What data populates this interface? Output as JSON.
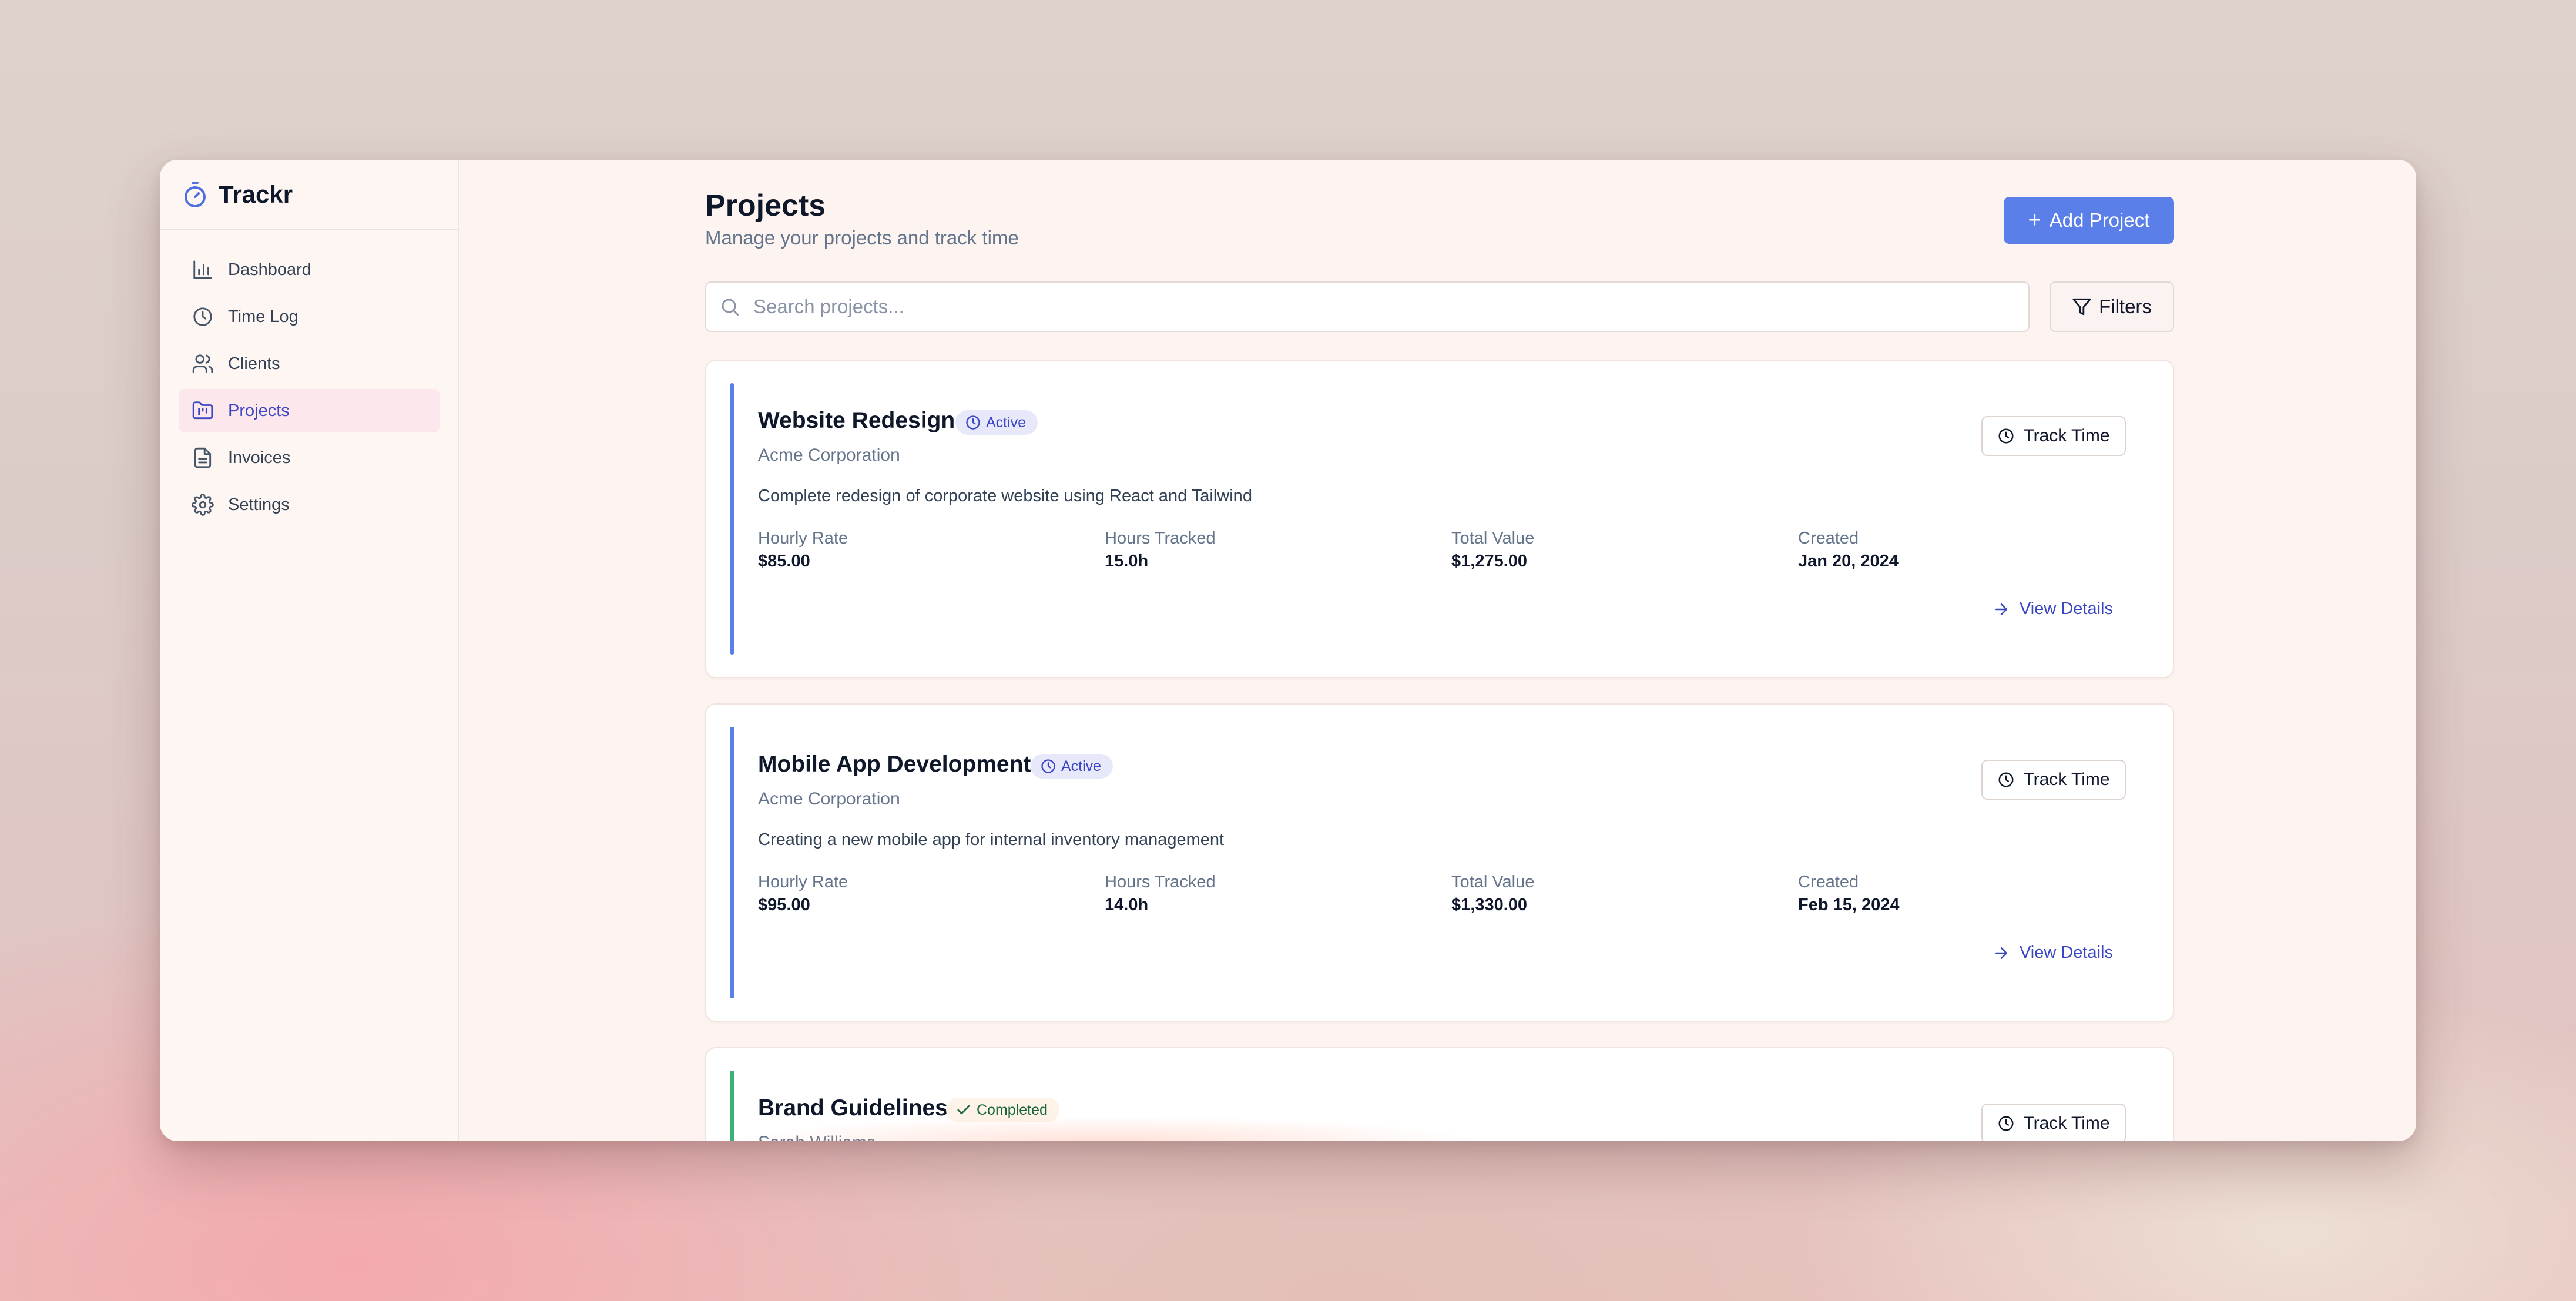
{
  "app": {
    "name": "Trackr"
  },
  "sidebar": {
    "items": [
      {
        "label": "Dashboard",
        "icon": "bar-chart-icon",
        "active": false
      },
      {
        "label": "Time Log",
        "icon": "clock-icon",
        "active": false
      },
      {
        "label": "Clients",
        "icon": "users-icon",
        "active": false
      },
      {
        "label": "Projects",
        "icon": "folder-kanban-icon",
        "active": true
      },
      {
        "label": "Invoices",
        "icon": "file-text-icon",
        "active": false
      },
      {
        "label": "Settings",
        "icon": "gear-icon",
        "active": false
      }
    ]
  },
  "header": {
    "title": "Projects",
    "subtitle": "Manage your projects and track time",
    "add_button": "Add Project"
  },
  "search": {
    "placeholder": "Search projects...",
    "value": ""
  },
  "filters_button": "Filters",
  "colors": {
    "accent": "#5b7fe9",
    "active_nav_text": "#3b46c4",
    "active_status_accent": "#5b7fe9",
    "completed_status_accent": "#3bb273"
  },
  "projects": [
    {
      "name": "Website Redesign",
      "status": "Active",
      "client": "Acme Corporation",
      "description": "Complete redesign of corporate website using React and Tailwind",
      "hourly_rate_label": "Hourly Rate",
      "hourly_rate": "$85.00",
      "hours_label": "Hours Tracked",
      "hours": "15.0h",
      "total_label": "Total Value",
      "total": "$1,275.00",
      "created_label": "Created",
      "created": "Jan 20, 2024",
      "track_button": "Track Time",
      "view_link": "View Details"
    },
    {
      "name": "Mobile App Development",
      "status": "Active",
      "client": "Acme Corporation",
      "description": "Creating a new mobile app for internal inventory management",
      "hourly_rate_label": "Hourly Rate",
      "hourly_rate": "$95.00",
      "hours_label": "Hours Tracked",
      "hours": "14.0h",
      "total_label": "Total Value",
      "total": "$1,330.00",
      "created_label": "Created",
      "created": "Feb 15, 2024",
      "track_button": "Track Time",
      "view_link": "View Details"
    },
    {
      "name": "Brand Guidelines",
      "status": "Completed",
      "client": "Sarah Williams",
      "track_button": "Track Time"
    }
  ]
}
